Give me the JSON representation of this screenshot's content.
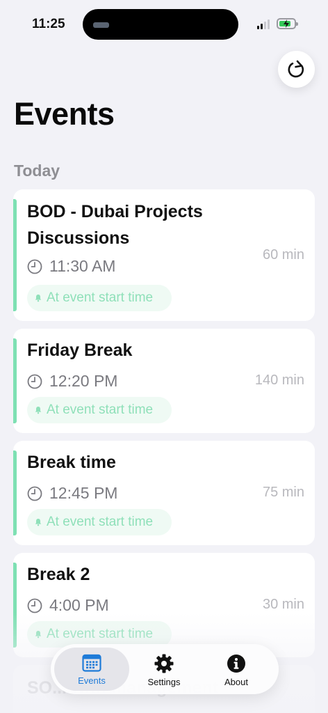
{
  "status_bar": {
    "time": "11:25"
  },
  "header": {
    "title": "Events"
  },
  "section": {
    "label": "Today"
  },
  "events": [
    {
      "title": "BOD - Dubai Projects Discussions",
      "time": "11:30 AM",
      "duration": "60 min",
      "reminder": "At event start time"
    },
    {
      "title": "Friday Break",
      "time": "12:20 PM",
      "duration": "140 min",
      "reminder": "At event start time"
    },
    {
      "title": "Break time",
      "time": "12:45 PM",
      "duration": "75 min",
      "reminder": "At event start time"
    },
    {
      "title": "Break 2",
      "time": "4:00 PM",
      "duration": "30 min",
      "reminder": "At event start time"
    }
  ],
  "partial_event": {
    "title": "SO... with management"
  },
  "tabs": [
    {
      "label": "Events",
      "icon": "calendar-icon",
      "active": true
    },
    {
      "label": "Settings",
      "icon": "gear-icon",
      "active": false
    },
    {
      "label": "About",
      "icon": "info-icon",
      "active": false
    }
  ],
  "colors": {
    "accent": "#1e7bd8",
    "event_bar": "#7ee0b3",
    "reminder_text": "#8fe0b9",
    "reminder_bg": "#effaf4",
    "background": "#f2f2f7"
  }
}
